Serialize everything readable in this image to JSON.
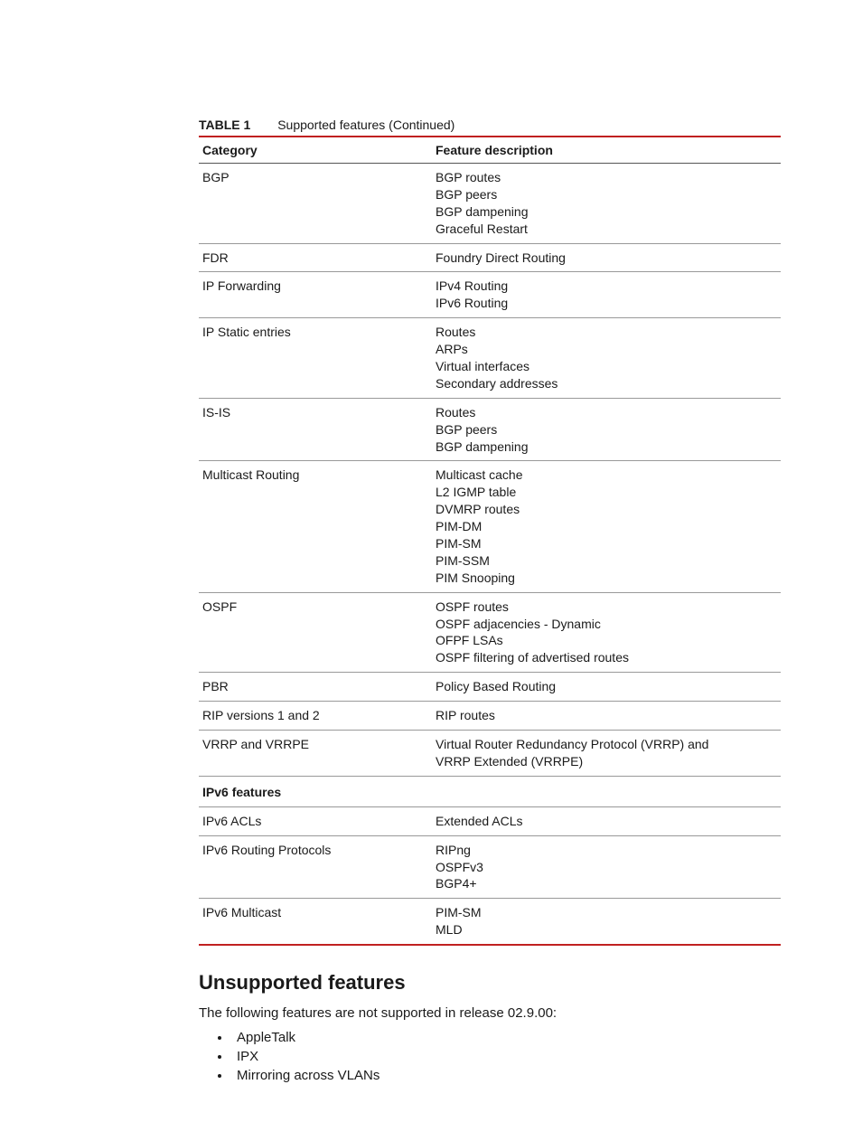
{
  "table": {
    "label": "TABLE 1",
    "caption": "Supported features (Continued)",
    "headers": {
      "col1": "Category",
      "col2": "Feature description"
    },
    "rows": [
      {
        "category": "BGP",
        "features": [
          "BGP routes",
          "BGP peers",
          "BGP dampening",
          "Graceful Restart"
        ]
      },
      {
        "category": "FDR",
        "features": [
          "Foundry Direct Routing"
        ]
      },
      {
        "category": "IP Forwarding",
        "features": [
          "IPv4 Routing",
          "IPv6 Routing"
        ]
      },
      {
        "category": "IP Static entries",
        "features": [
          "Routes",
          "ARPs",
          "Virtual interfaces",
          "Secondary addresses"
        ]
      },
      {
        "category": "IS-IS",
        "features": [
          "Routes",
          "BGP peers",
          "BGP dampening"
        ]
      },
      {
        "category": "Multicast Routing",
        "features": [
          "Multicast cache",
          "L2 IGMP table",
          "DVMRP routes",
          "PIM-DM",
          "PIM-SM",
          "PIM-SSM",
          "PIM Snooping"
        ]
      },
      {
        "category": "OSPF",
        "features": [
          "OSPF routes",
          "OSPF adjacencies - Dynamic",
          "OFPF LSAs",
          "OSPF filtering of advertised routes"
        ]
      },
      {
        "category": "PBR",
        "features": [
          "Policy Based Routing"
        ]
      },
      {
        "category": "RIP versions 1 and 2",
        "features": [
          "RIP routes"
        ]
      },
      {
        "category": "VRRP and VRRPE",
        "features": [
          "Virtual Router Redundancy Protocol (VRRP) and",
          "VRRP Extended (VRRPE)"
        ]
      }
    ],
    "section_header": "IPv6 features",
    "rows2": [
      {
        "category": "IPv6 ACLs",
        "features": [
          "Extended ACLs"
        ]
      },
      {
        "category": "IPv6 Routing Protocols",
        "features": [
          "RIPng",
          "OSPFv3",
          "BGP4+"
        ]
      },
      {
        "category": "IPv6 Multicast",
        "features": [
          "PIM-SM",
          "MLD"
        ]
      }
    ]
  },
  "section": {
    "heading": "Unsupported features",
    "intro": "The following features are not supported in release 02.9.00:",
    "items": [
      "AppleTalk",
      "IPX",
      "Mirroring across VLANs"
    ]
  }
}
